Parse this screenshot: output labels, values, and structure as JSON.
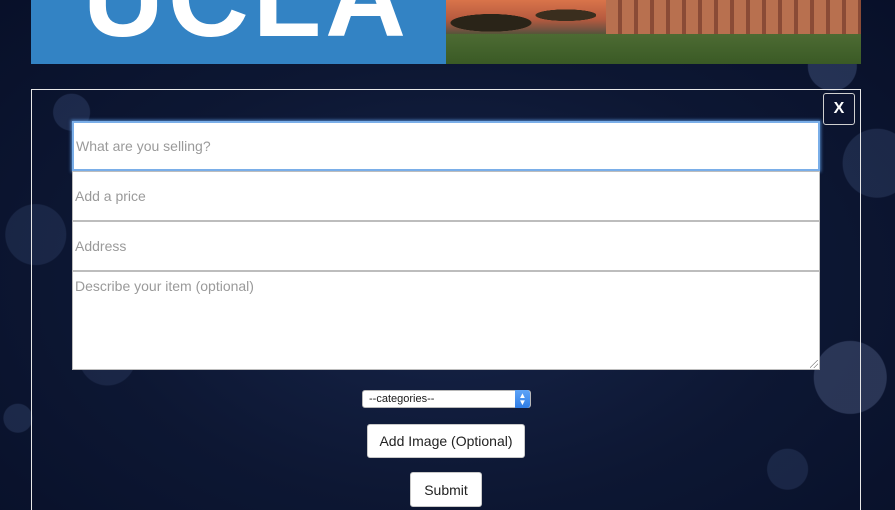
{
  "header": {
    "logo_text": "UCLA",
    "photo_alt": "campus-photo"
  },
  "modal": {
    "close_label": "X",
    "form": {
      "title_placeholder": "What are you selling?",
      "price_placeholder": "Add a price",
      "address_placeholder": "Address",
      "description_placeholder": "Describe your item (optional)",
      "category_selected": "--categories--",
      "add_image_label": "Add Image (Optional)",
      "submit_label": "Submit"
    }
  },
  "colors": {
    "logo_blue": "#3383c4",
    "background_navy": "#0d1733",
    "focus_ring": "#7aaee8"
  }
}
